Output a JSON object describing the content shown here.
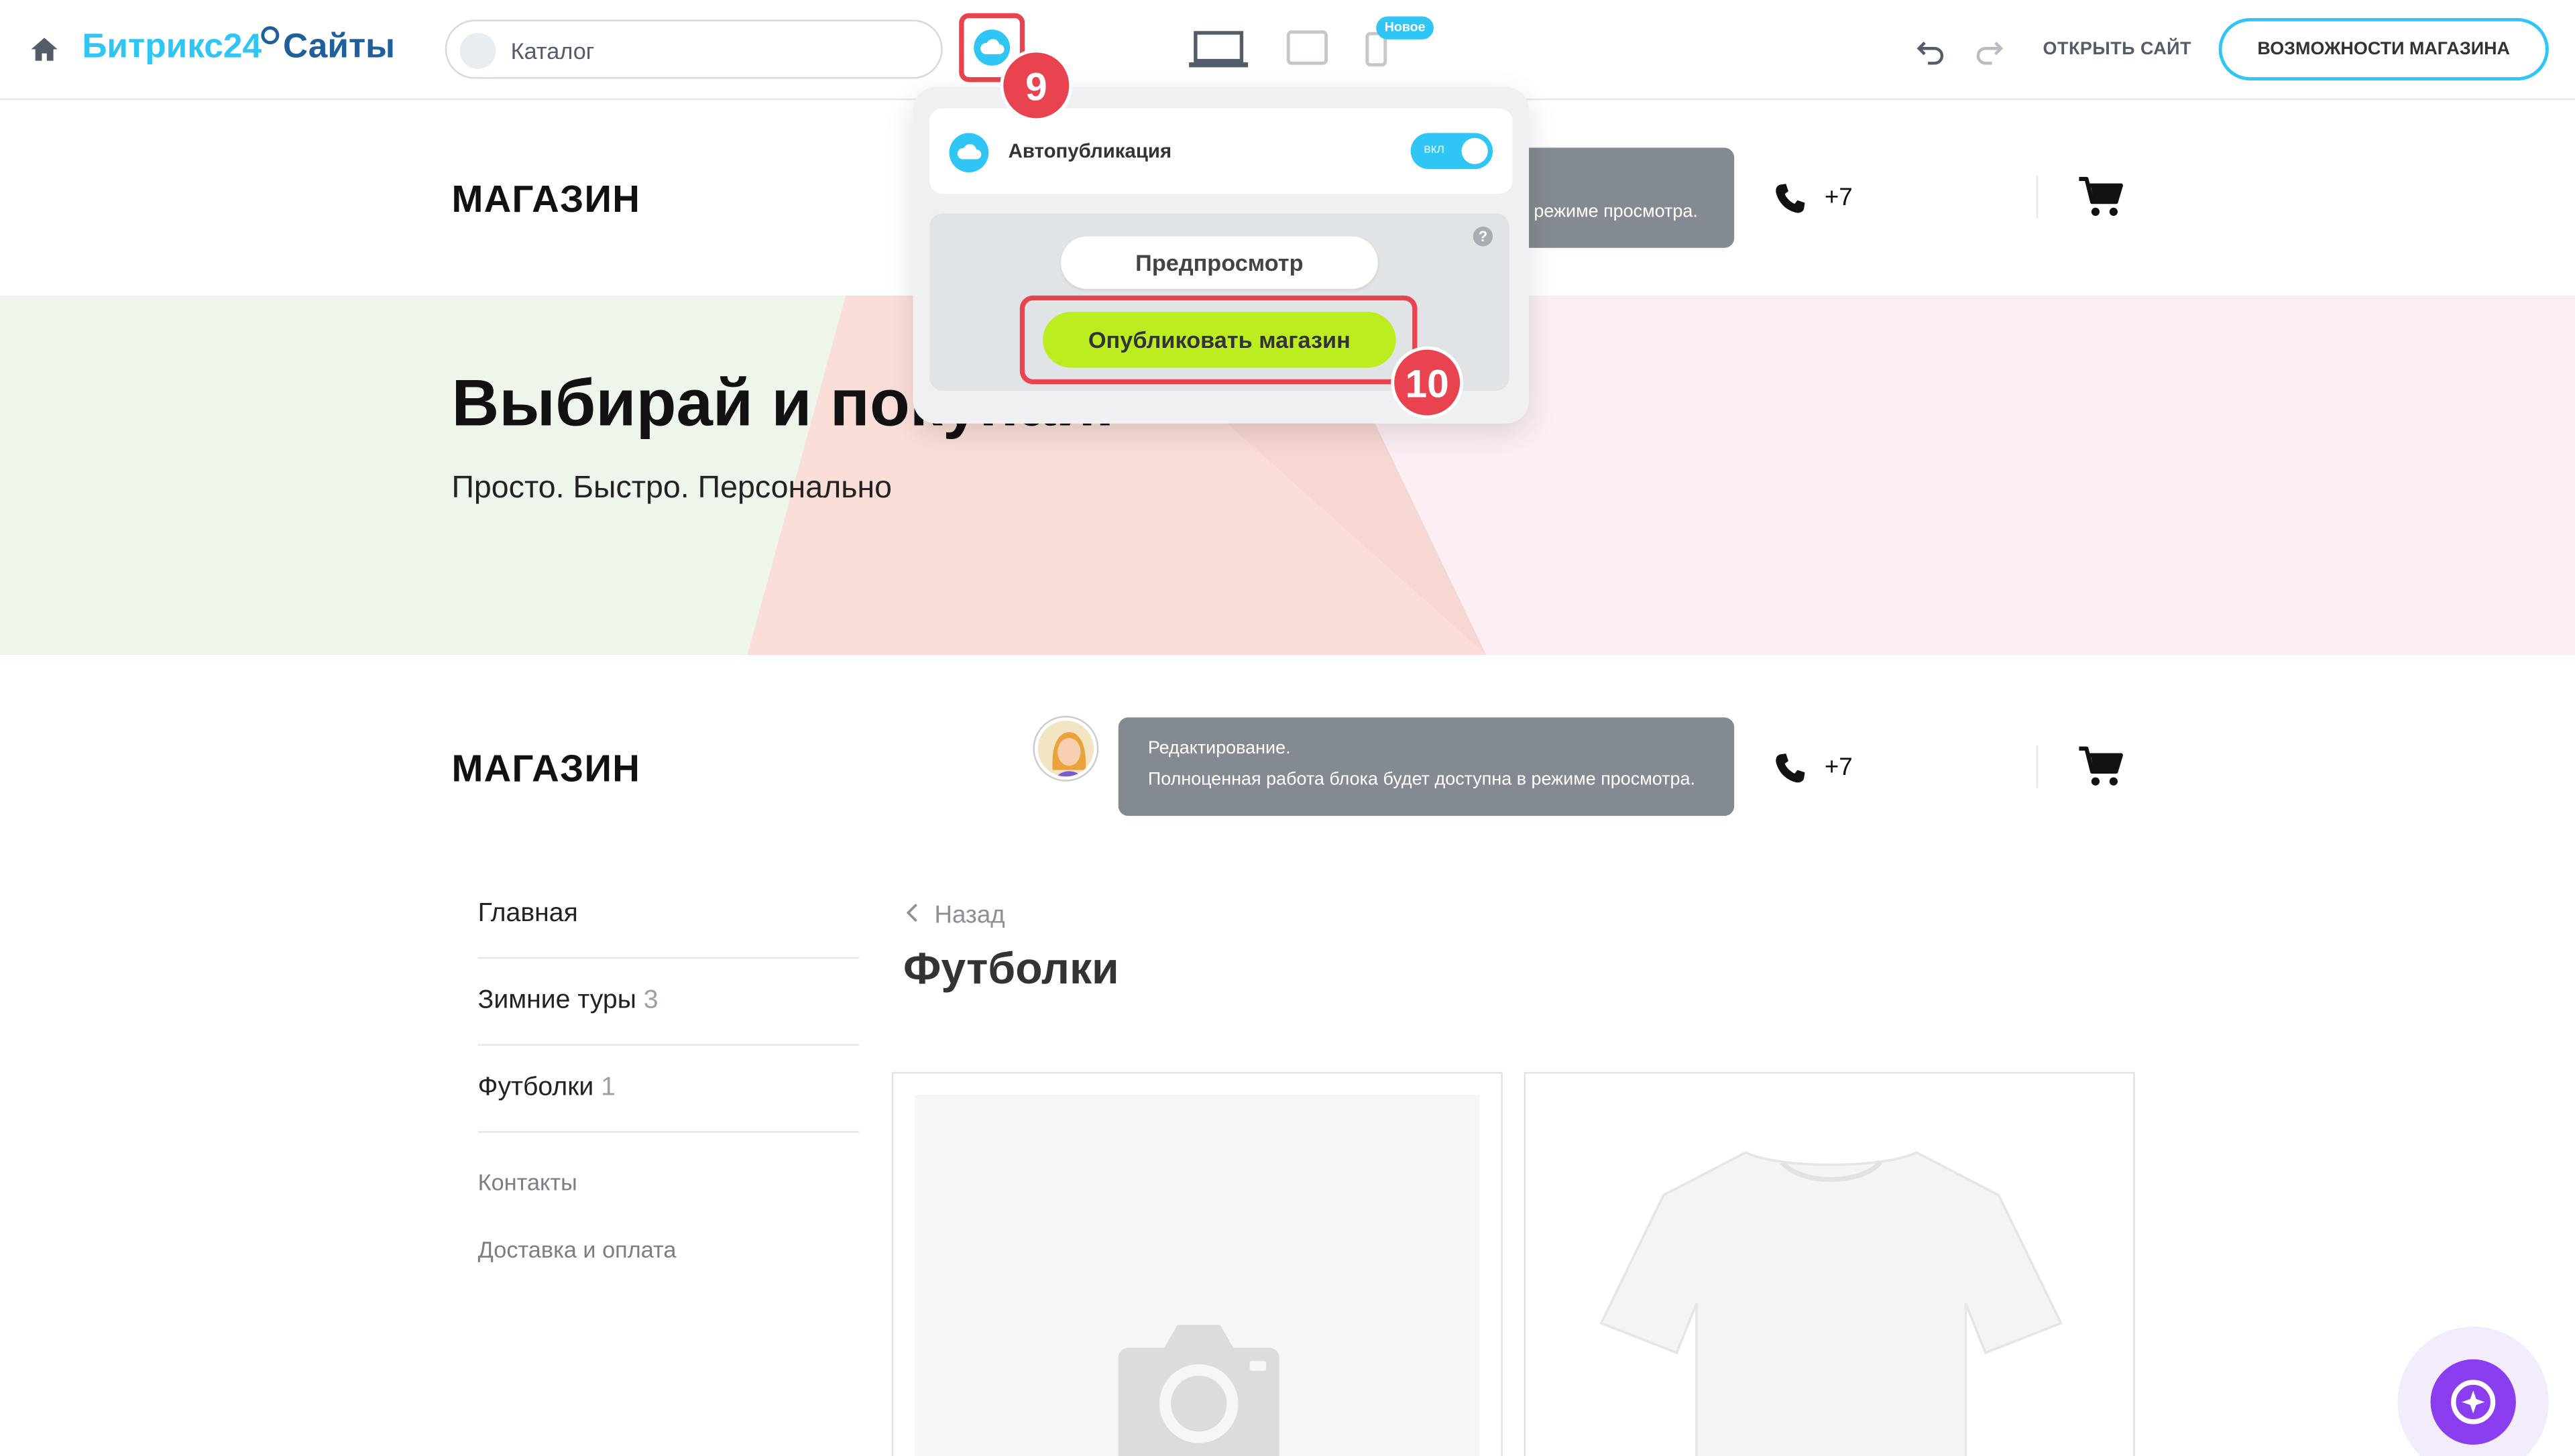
{
  "topbar": {
    "brand_part1": "Битрикс24",
    "brand_part2": "Сайты",
    "catalog_label": "Каталог",
    "new_tag": "Новое",
    "open_site": "ОТКРЫТЬ САЙТ",
    "features_button": "ВОЗМОЖНОСТИ МАГАЗИНА"
  },
  "annotations": {
    "step9": "9",
    "step10": "10"
  },
  "publish_popup": {
    "autopublish_label": "Автопубликация",
    "toggle_label": "вкл",
    "toggle_on": true,
    "help": "?",
    "preview_button": "Предпросмотр",
    "publish_button": "Опубликовать магазин"
  },
  "header1": {
    "shop_title": "МАГАЗИН",
    "tooltip_visible_tail": "режиме просмотра.",
    "phone": "+7"
  },
  "hero": {
    "title": "Выбирай и покупай.",
    "subtitle": "Просто. Быстро. Персонально"
  },
  "header2": {
    "shop_title": "МАГАЗИН",
    "tooltip_line1": "Редактирование.",
    "tooltip_line2": "Полноценная работа блока будет доступна в режиме просмотра.",
    "phone": "+7"
  },
  "sidebar": {
    "items": [
      {
        "label": "Главная",
        "count": ""
      },
      {
        "label": "Зимние туры",
        "count": "3"
      },
      {
        "label": "Футболки",
        "count": "1"
      }
    ],
    "secondary": [
      "Контакты",
      "Доставка и оплата"
    ]
  },
  "catalog": {
    "back": "Назад",
    "title": "Футболки"
  },
  "colors": {
    "accent": "#2fc6f6",
    "publish": "#bbed21",
    "highlight": "#e8434f",
    "ai": "#8b3df0"
  }
}
